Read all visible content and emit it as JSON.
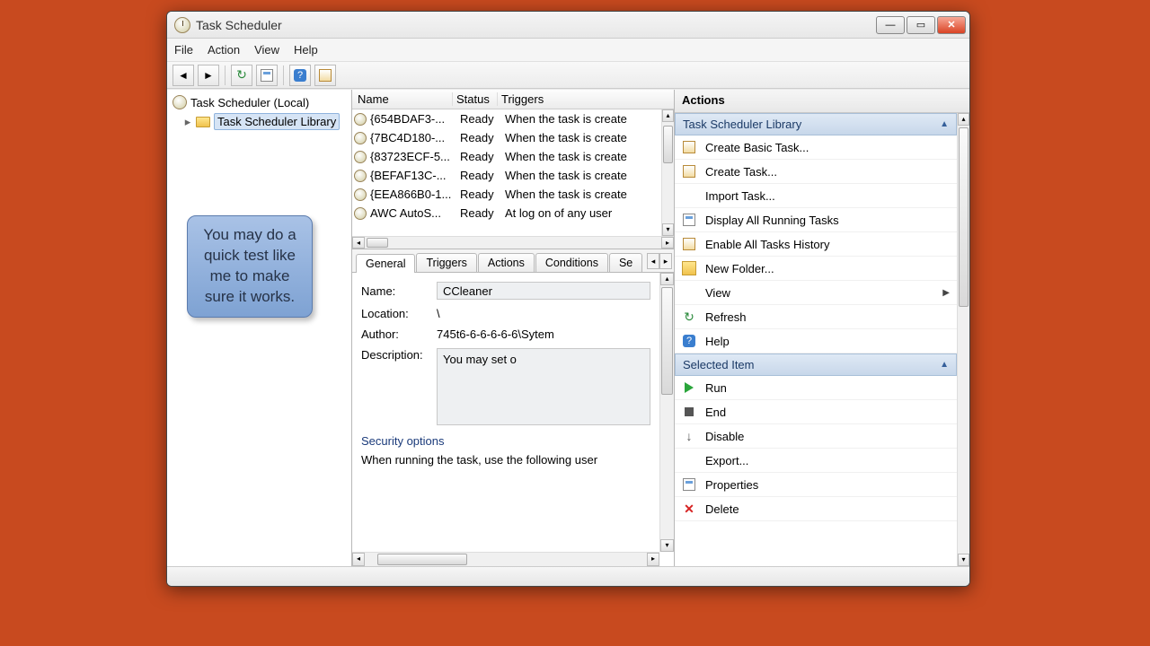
{
  "window": {
    "title": "Task Scheduler"
  },
  "menu": {
    "file": "File",
    "action": "Action",
    "view": "View",
    "help": "Help"
  },
  "tree": {
    "root": "Task Scheduler (Local)",
    "library": "Task Scheduler Library"
  },
  "callout": "You may do a quick test like me to make sure it works.",
  "columns": {
    "name": "Name",
    "status": "Status",
    "triggers": "Triggers"
  },
  "tasks": [
    {
      "name": "{654BDAF3-...",
      "status": "Ready",
      "trigger": "When the task is create"
    },
    {
      "name": "{7BC4D180-...",
      "status": "Ready",
      "trigger": "When the task is create"
    },
    {
      "name": "{83723ECF-5...",
      "status": "Ready",
      "trigger": "When the task is create"
    },
    {
      "name": "{BEFAF13C-...",
      "status": "Ready",
      "trigger": "When the task is create"
    },
    {
      "name": "{EEA866B0-1...",
      "status": "Ready",
      "trigger": "When the task is create"
    },
    {
      "name": "AWC AutoS...",
      "status": "Ready",
      "trigger": "At log on of any user"
    }
  ],
  "tabs": {
    "general": "General",
    "triggers": "Triggers",
    "actions": "Actions",
    "conditions": "Conditions",
    "settings": "Se"
  },
  "detail": {
    "labels": {
      "name": "Name:",
      "location": "Location:",
      "author": "Author:",
      "description": "Description:",
      "security": "Security options",
      "runAs": "When running the task, use the following user"
    },
    "name": "CCleaner",
    "location": "\\",
    "author": "745t6-6-6-6-6-6\\Sytem",
    "description": "You may set o"
  },
  "actions": {
    "title": "Actions",
    "group1": "Task Scheduler Library",
    "createBasic": "Create Basic Task...",
    "createTask": "Create Task...",
    "importTask": "Import Task...",
    "displayRunning": "Display All Running Tasks",
    "enableHistory": "Enable All Tasks History",
    "newFolder": "New Folder...",
    "view": "View",
    "refresh": "Refresh",
    "help": "Help",
    "group2": "Selected Item",
    "run": "Run",
    "end": "End",
    "disable": "Disable",
    "export": "Export...",
    "properties": "Properties",
    "delete": "Delete"
  }
}
